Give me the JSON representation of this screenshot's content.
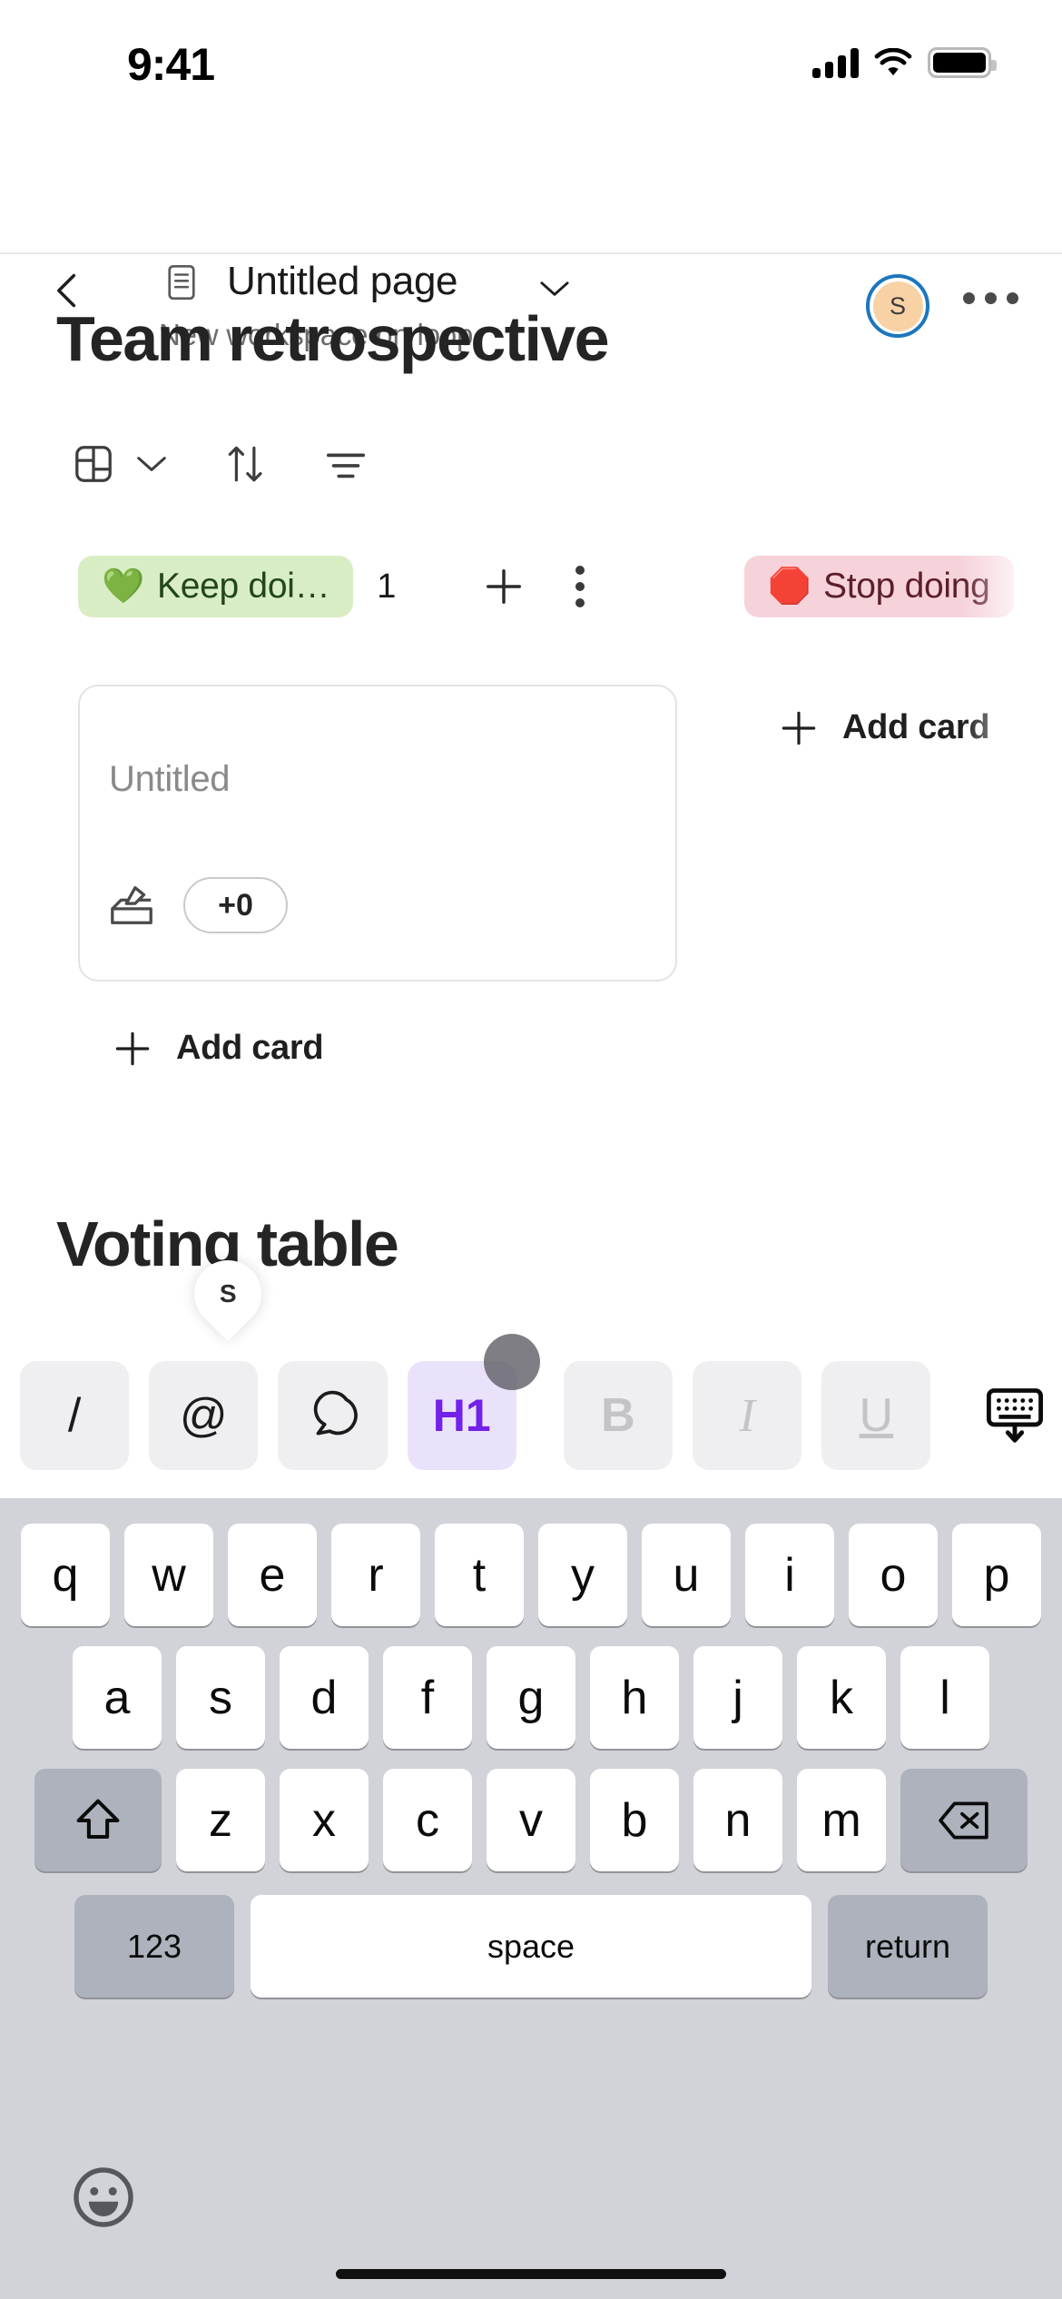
{
  "status_bar": {
    "time": "9:41",
    "icons": [
      "cellular-signal-icon",
      "wifi-icon",
      "battery-icon"
    ]
  },
  "header": {
    "back_label": "back-chevron-icon",
    "doc_icon": "document-icon",
    "title": "Untitled page",
    "title_chevron": "chevron-down-icon",
    "subtitle": "New workspace on loop",
    "avatar_initial": "S",
    "avatar_ring_color": "#1d76bd",
    "avatar_fill_color": "#f8d2a5",
    "more_label": "more-options-icon"
  },
  "page": {
    "title": "Team retrospective",
    "second_heading": "Voting table"
  },
  "view_toolbar": {
    "items": [
      {
        "name": "board-view-icon",
        "label": "Board view"
      },
      {
        "name": "chevron-down-icon",
        "label": "Change view"
      },
      {
        "name": "sort-icon",
        "label": "Sort"
      },
      {
        "name": "filter-icon",
        "label": "Filter"
      }
    ]
  },
  "board": {
    "columns": [
      {
        "emoji": "💚",
        "label": "Keep doi…",
        "count": "1",
        "pill_bg": "#d9edc5",
        "pill_fg": "#23461a",
        "add_label": "Add card",
        "cards": [
          {
            "title": "Untitled",
            "vote_icon": "ballot-box-icon",
            "votes": "+0"
          }
        ]
      },
      {
        "emoji": "🛑",
        "label": "Stop doing",
        "count": "",
        "pill_bg": "#f6d3db",
        "pill_fg": "#5c1d2c",
        "add_label": "Add card",
        "cards": []
      }
    ]
  },
  "presence": {
    "initial": "S"
  },
  "format_toolbar": {
    "buttons": [
      {
        "name": "slash-command-button",
        "label": "/",
        "state": "enabled"
      },
      {
        "name": "mention-button",
        "label": "@",
        "state": "enabled"
      },
      {
        "name": "comment-button",
        "label": "comment-icon",
        "state": "enabled"
      },
      {
        "name": "heading1-button",
        "label": "H1",
        "state": "active"
      },
      {
        "name": "bold-button",
        "label": "B",
        "state": "disabled"
      },
      {
        "name": "italic-button",
        "label": "I",
        "state": "disabled"
      },
      {
        "name": "underline-button",
        "label": "U",
        "state": "disabled"
      },
      {
        "name": "dismiss-keyboard-button",
        "label": "keyboard-dismiss-icon",
        "state": "enabled"
      }
    ],
    "active_color": "#7320e8",
    "active_bg": "#eae2fb"
  },
  "keyboard": {
    "row1": [
      "q",
      "w",
      "e",
      "r",
      "t",
      "y",
      "u",
      "i",
      "o",
      "p"
    ],
    "row2": [
      "a",
      "s",
      "d",
      "f",
      "g",
      "h",
      "j",
      "k",
      "l"
    ],
    "row3": [
      "z",
      "x",
      "c",
      "v",
      "b",
      "n",
      "m"
    ],
    "shift_label": "shift-icon",
    "backspace_label": "backspace-icon",
    "numbers_label": "123",
    "space_label": "space",
    "return_label": "return",
    "emoji_label": "emoji-icon"
  }
}
